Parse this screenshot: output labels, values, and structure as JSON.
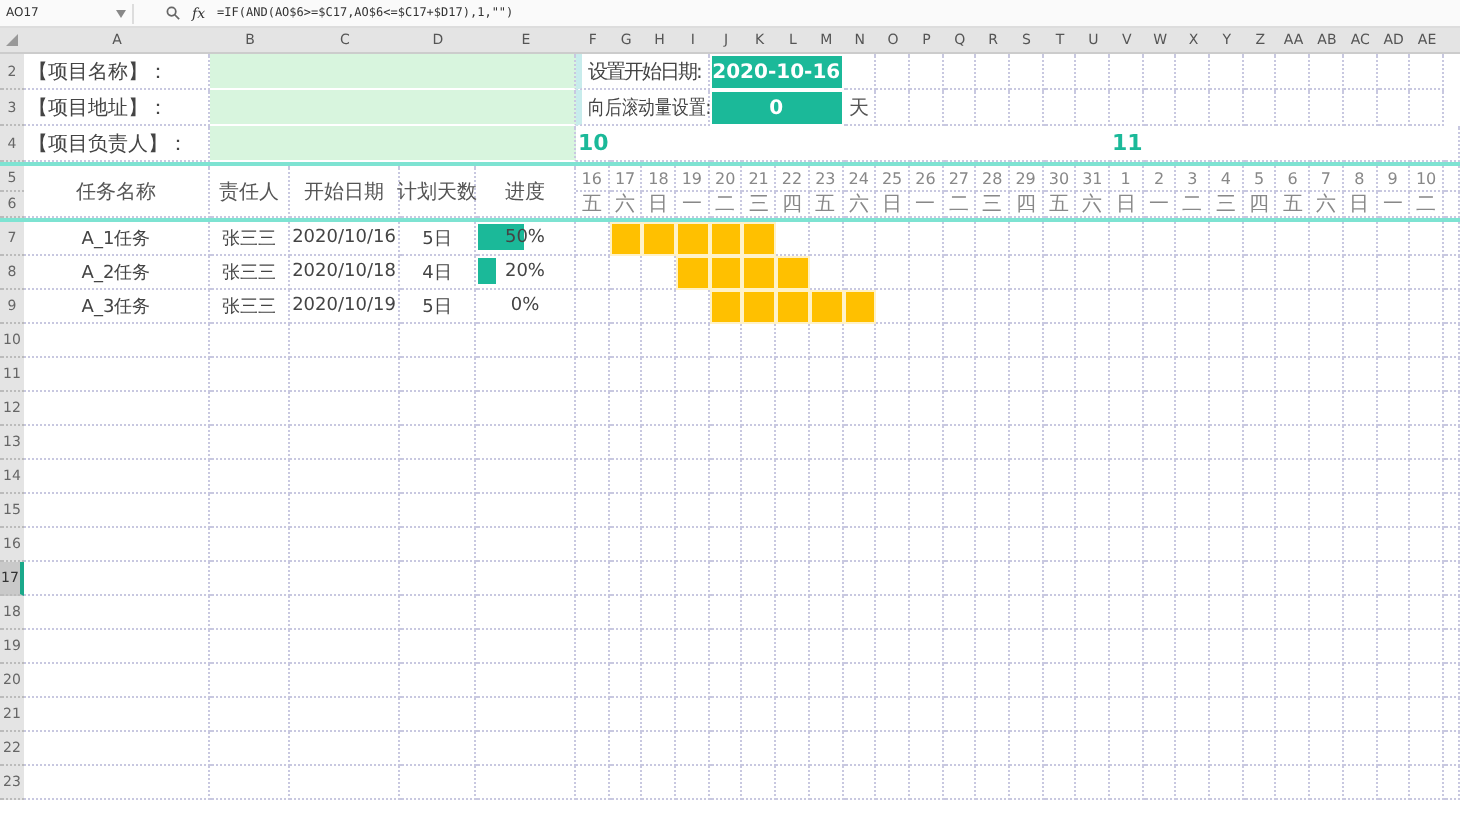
{
  "formula_bar": {
    "cell_name": "AO17",
    "fx": "fx",
    "formula": "=IF(AND(AO$6>=$C17,AO$6<=$C17+$D17),1,\"\")"
  },
  "column_headers": [
    "A",
    "B",
    "C",
    "D",
    "E",
    "F",
    "G",
    "H",
    "I",
    "J",
    "K",
    "L",
    "M",
    "N",
    "O",
    "P",
    "Q",
    "R",
    "S",
    "T",
    "U",
    "V",
    "W",
    "X",
    "Y",
    "Z",
    "AA",
    "AB",
    "AC",
    "AD",
    "AE"
  ],
  "row_headers": [
    {
      "label": "2",
      "selected": false
    },
    {
      "label": "3",
      "selected": false
    },
    {
      "label": "4",
      "selected": false
    },
    {
      "label": "5",
      "selected": false
    },
    {
      "label": "6",
      "selected": false
    },
    {
      "label": "7",
      "selected": false
    },
    {
      "label": "8",
      "selected": false
    },
    {
      "label": "9",
      "selected": false
    },
    {
      "label": "10",
      "selected": false
    },
    {
      "label": "11",
      "selected": false
    },
    {
      "label": "12",
      "selected": false
    },
    {
      "label": "13",
      "selected": false
    },
    {
      "label": "14",
      "selected": false
    },
    {
      "label": "15",
      "selected": false
    },
    {
      "label": "16",
      "selected": false
    },
    {
      "label": "17",
      "selected": true
    },
    {
      "label": "18",
      "selected": false
    },
    {
      "label": "19",
      "selected": false
    },
    {
      "label": "20",
      "selected": false
    },
    {
      "label": "21",
      "selected": false
    },
    {
      "label": "22",
      "selected": false
    },
    {
      "label": "23",
      "selected": false
    }
  ],
  "project_fields": [
    {
      "label": "【项目名称】："
    },
    {
      "label": "【项目地址】："
    },
    {
      "label": "【项目负责人】："
    }
  ],
  "settings": {
    "start_date_label": "设置开始日期:",
    "start_date": "2020-10-16",
    "scroll_label": "向后滚动量设置:",
    "scroll_value": "0",
    "scroll_unit": "天"
  },
  "table_headers": [
    "任务名称",
    "责任人",
    "开始日期",
    "计划天数",
    "进度"
  ],
  "days": [
    {
      "day": "16",
      "weekday": "五",
      "month": "10"
    },
    {
      "day": "17",
      "weekday": "六"
    },
    {
      "day": "18",
      "weekday": "日"
    },
    {
      "day": "19",
      "weekday": "一"
    },
    {
      "day": "20",
      "weekday": "二"
    },
    {
      "day": "21",
      "weekday": "三"
    },
    {
      "day": "22",
      "weekday": "四"
    },
    {
      "day": "23",
      "weekday": "五"
    },
    {
      "day": "24",
      "weekday": "六"
    },
    {
      "day": "25",
      "weekday": "日"
    },
    {
      "day": "26",
      "weekday": "一"
    },
    {
      "day": "27",
      "weekday": "二"
    },
    {
      "day": "28",
      "weekday": "三"
    },
    {
      "day": "29",
      "weekday": "四"
    },
    {
      "day": "30",
      "weekday": "五"
    },
    {
      "day": "31",
      "weekday": "六"
    },
    {
      "day": "1",
      "weekday": "日",
      "month": "11"
    },
    {
      "day": "2",
      "weekday": "一"
    },
    {
      "day": "3",
      "weekday": "二"
    },
    {
      "day": "4",
      "weekday": "三"
    },
    {
      "day": "5",
      "weekday": "四"
    },
    {
      "day": "6",
      "weekday": "五"
    },
    {
      "day": "7",
      "weekday": "六"
    },
    {
      "day": "8",
      "weekday": "日"
    },
    {
      "day": "9",
      "weekday": "一"
    },
    {
      "day": "10",
      "weekday": "二"
    }
  ],
  "tasks": [
    {
      "name": "A_1任务",
      "owner": "张三三",
      "start": "2020/10/16",
      "duration": "5日",
      "progress": {
        "level": 0.5,
        "text": "50%"
      },
      "schedule": [
        {
          "filled": false
        },
        {
          "filled": true
        },
        {
          "filled": true
        },
        {
          "filled": true
        },
        {
          "filled": true
        },
        {
          "filled": true
        },
        {
          "filled": false
        },
        {
          "filled": false
        },
        {
          "filled": false
        },
        {
          "filled": false
        },
        {
          "filled": false
        },
        {
          "filled": false
        },
        {
          "filled": false
        },
        {
          "filled": false
        },
        {
          "filled": false
        },
        {
          "filled": false
        },
        {
          "filled": false
        },
        {
          "filled": false
        },
        {
          "filled": false
        },
        {
          "filled": false
        },
        {
          "filled": false
        },
        {
          "filled": false
        },
        {
          "filled": false
        },
        {
          "filled": false
        },
        {
          "filled": false
        },
        {
          "filled": false
        }
      ]
    },
    {
      "name": "A_2任务",
      "owner": "张三三",
      "start": "2020/10/18",
      "duration": "4日",
      "progress": {
        "level": 0.2,
        "text": "20%"
      },
      "schedule": [
        {
          "filled": false
        },
        {
          "filled": false
        },
        {
          "filled": false
        },
        {
          "filled": true
        },
        {
          "filled": true
        },
        {
          "filled": true
        },
        {
          "filled": true
        },
        {
          "filled": false
        },
        {
          "filled": false
        },
        {
          "filled": false
        },
        {
          "filled": false
        },
        {
          "filled": false
        },
        {
          "filled": false
        },
        {
          "filled": false
        },
        {
          "filled": false
        },
        {
          "filled": false
        },
        {
          "filled": false
        },
        {
          "filled": false
        },
        {
          "filled": false
        },
        {
          "filled": false
        },
        {
          "filled": false
        },
        {
          "filled": false
        },
        {
          "filled": false
        },
        {
          "filled": false
        },
        {
          "filled": false
        },
        {
          "filled": false
        }
      ]
    },
    {
      "name": "A_3任务",
      "owner": "张三三",
      "start": "2020/10/19",
      "duration": "5日",
      "progress": {
        "text": "0%"
      },
      "schedule": [
        {
          "filled": false
        },
        {
          "filled": false
        },
        {
          "filled": false
        },
        {
          "filled": false
        },
        {
          "filled": true
        },
        {
          "filled": true
        },
        {
          "filled": true
        },
        {
          "filled": true
        },
        {
          "filled": true
        },
        {
          "filled": false
        },
        {
          "filled": false
        },
        {
          "filled": false
        },
        {
          "filled": false
        },
        {
          "filled": false
        },
        {
          "filled": false
        },
        {
          "filled": false
        },
        {
          "filled": false
        },
        {
          "filled": false
        },
        {
          "filled": false
        },
        {
          "filled": false
        },
        {
          "filled": false
        },
        {
          "filled": false
        },
        {
          "filled": false
        },
        {
          "filled": false
        },
        {
          "filled": false
        },
        {
          "filled": false
        }
      ]
    }
  ]
}
